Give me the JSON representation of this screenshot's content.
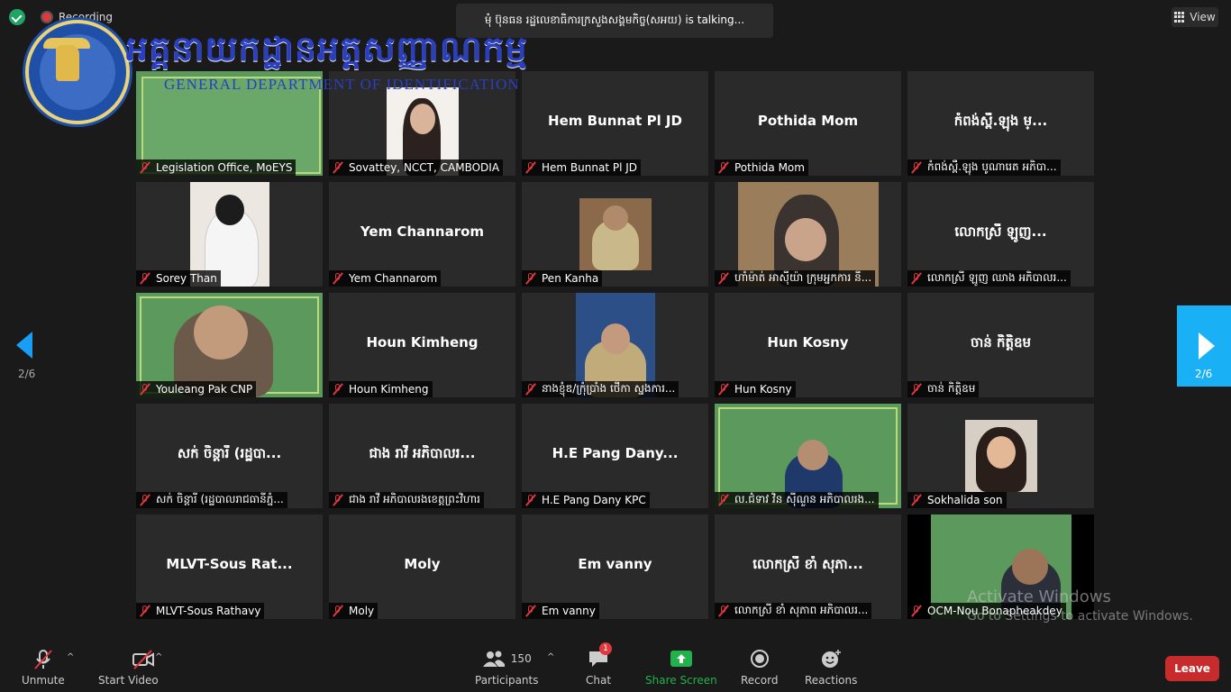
{
  "topbar": {
    "recording_label": "Recording",
    "talking_text": "មុំ ប៊ុនធន រដ្ឋលេខាធិការក្រសួងសង្គមកិច្ច(សអយ) is talking...",
    "view_label": "View"
  },
  "banner": {
    "title_km": "អគ្គនាយកដ្ឋានអត្តសញ្ញាណកម្ម",
    "title_en": "GENERAL DEPARTMENT OF IDENTIFICATION"
  },
  "pagination": {
    "left": "2/6",
    "right": "2/6"
  },
  "participants": [
    {
      "name": "",
      "label": "Legislation Office, MoEYS"
    },
    {
      "name": "",
      "label": "Sovattey, NCCT, CAMBODIA"
    },
    {
      "name": "Hem Bunnat Pl JD",
      "label": "Hem Bunnat Pl JD"
    },
    {
      "name": "Pothida Mom",
      "label": "Pothida Mom"
    },
    {
      "name": "កំពង់ស្ពឺ.ឡុង ម្...",
      "label": "កំពង់ស្ពឺ.ឡុង បូណារេត អភិបា..."
    },
    {
      "name": "",
      "label": "Sorey Than"
    },
    {
      "name": "Yem Channarom",
      "label": "Yem Channarom"
    },
    {
      "name": "",
      "label": "Pen Kanha"
    },
    {
      "name": "",
      "label": "ហាំម៉ាត់ អាស៊ីយ៉ា ក្រុមអ្នកការ នី..."
    },
    {
      "name": "លោកស្រី ឡូញ...",
      "label": "លោកស្រី ឡូញ ឈាង អភិបាលរ..."
    },
    {
      "name": "",
      "label": "Youleang Pak CNP"
    },
    {
      "name": "Houn Kimheng",
      "label": "Houn Kimheng"
    },
    {
      "name": "",
      "label": "នាងខ្ញុំឌ/ក្រុំប្រាំង ថើកា ស្នងការ..."
    },
    {
      "name": "Hun Kosny",
      "label": "Hun Kosny"
    },
    {
      "name": "ចាន់ កិត្តិឧម",
      "label": "ចាន់ កិត្តិឧម"
    },
    {
      "name": "សក់ ចិន្តារី (រដ្ឋបា...",
      "label": "សក់ ចិន្តារី (រដ្ឋបាលរាជធានីភ្នំ..."
    },
    {
      "name": "ជាង រាវី អភិបាលរ...",
      "label": "ជាង រាវី អភិបាលរងខេត្តព្រះវិហារ"
    },
    {
      "name": "H.E Pang Dany...",
      "label": "H.E Pang Dany KPC"
    },
    {
      "name": "",
      "label": "ល.ជំទាវ វិន ស៊ីណួន អភិបាលរង..."
    },
    {
      "name": "",
      "label": "Sokhalida son"
    },
    {
      "name": "MLVT-Sous Rat...",
      "label": "MLVT-Sous Rathavy"
    },
    {
      "name": "Moly",
      "label": "Moly"
    },
    {
      "name": "Em vanny",
      "label": "Em vanny"
    },
    {
      "name": "លោកស្រី ខាំ សុភា...",
      "label": "លោកស្រី ខាំ សុភាព អភិបាលរ..."
    },
    {
      "name": "",
      "label": "OCM-Nou Bonapheakdey"
    }
  ],
  "watermark": {
    "title": "Activate Windows",
    "subtitle": "Go to Settings to activate Windows."
  },
  "toolbar": {
    "unmute": "Unmute",
    "start_video": "Start Video",
    "participants_count": "150",
    "participants": "Participants",
    "chat": "Chat",
    "chat_badge": "1",
    "share_screen": "Share Screen",
    "record": "Record",
    "reactions": "Reactions",
    "leave": "Leave"
  },
  "colors": {
    "share_green": "#22b14c",
    "leave_red": "#c72b2b",
    "nav_blue": "#1ab0f5"
  }
}
